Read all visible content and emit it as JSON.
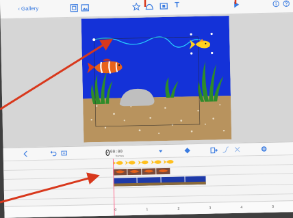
{
  "topbar": {
    "back_label": "Gallery",
    "text_tool_label": "T"
  },
  "timeline": {
    "time_main": "0",
    "time_fraction": "00:00",
    "time_sub": "frames",
    "ruler": [
      "0",
      "1",
      "2",
      "3",
      "4",
      "5"
    ],
    "tracks": [
      {
        "name": "goldfish",
        "clip_count": 5
      },
      {
        "name": "clownfish",
        "clip_count": 4
      },
      {
        "name": "background",
        "clip_count": 4
      }
    ]
  },
  "colors": {
    "accent": "#3a7be0",
    "sky": "#1432d8",
    "sand": "#b8935e",
    "arrow": "#d8381c",
    "playhead": "#ff6a8e"
  },
  "icons": {
    "topbar": [
      "fullscreen-icon",
      "photo-icon",
      "star-icon",
      "shape-icon",
      "media-icon",
      "text-icon",
      "play-icon",
      "info-icon",
      "help-icon"
    ],
    "timeline": [
      "collapse-icon",
      "undo-icon",
      "redo-icon",
      "keyframe-icon",
      "insert-icon",
      "curve-icon",
      "cut-icon",
      "settings-icon"
    ]
  }
}
